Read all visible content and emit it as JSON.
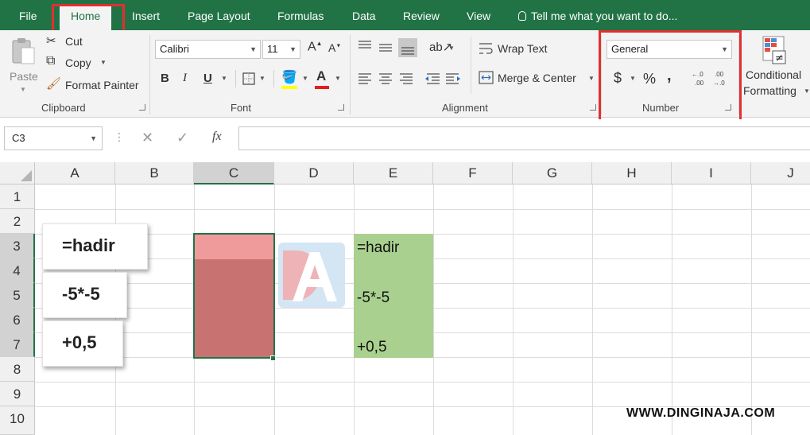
{
  "menu": {
    "file": "File",
    "home": "Home",
    "insert": "Insert",
    "page_layout": "Page Layout",
    "formulas": "Formulas",
    "data": "Data",
    "review": "Review",
    "view": "View",
    "tell_me": "Tell me what you want to do..."
  },
  "ribbon": {
    "clipboard": {
      "label": "Clipboard",
      "paste": "Paste",
      "cut": "Cut",
      "copy": "Copy",
      "format_painter": "Format Painter"
    },
    "font": {
      "label": "Font",
      "name": "Calibri",
      "size": "11",
      "bold": "B",
      "italic": "I",
      "underline": "U"
    },
    "alignment": {
      "label": "Alignment",
      "wrap_text": "Wrap Text",
      "merge_center": "Merge & Center"
    },
    "number": {
      "label": "Number",
      "format": "General",
      "currency": "$",
      "percent": "%",
      "comma": ","
    },
    "styles": {
      "conditional": "Conditional",
      "formatting": "Formatting"
    }
  },
  "formula_bar": {
    "name_box": "C3",
    "fx": "fx",
    "value": ""
  },
  "grid": {
    "columns": [
      "A",
      "B",
      "C",
      "D",
      "E",
      "F",
      "G",
      "H",
      "I",
      "J"
    ],
    "rows": [
      "1",
      "2",
      "3",
      "4",
      "5",
      "6",
      "7",
      "8",
      "9",
      "10"
    ],
    "selected_column": "C",
    "selected_rows": [
      "3",
      "4",
      "5",
      "6",
      "7"
    ]
  },
  "callouts": [
    "=hadir",
    "-5*-5",
    "+0,5"
  ],
  "cells_e": [
    "=hadir",
    "-5*-5",
    "+0,5"
  ],
  "colors": {
    "excel_green": "#217346",
    "highlight_red": "#e03030",
    "cell_green": "#a9d08e",
    "selection_light": "#f09b9b",
    "selection_dark": "#c97272"
  },
  "watermark": "WWW.DINGINAJA.COM"
}
